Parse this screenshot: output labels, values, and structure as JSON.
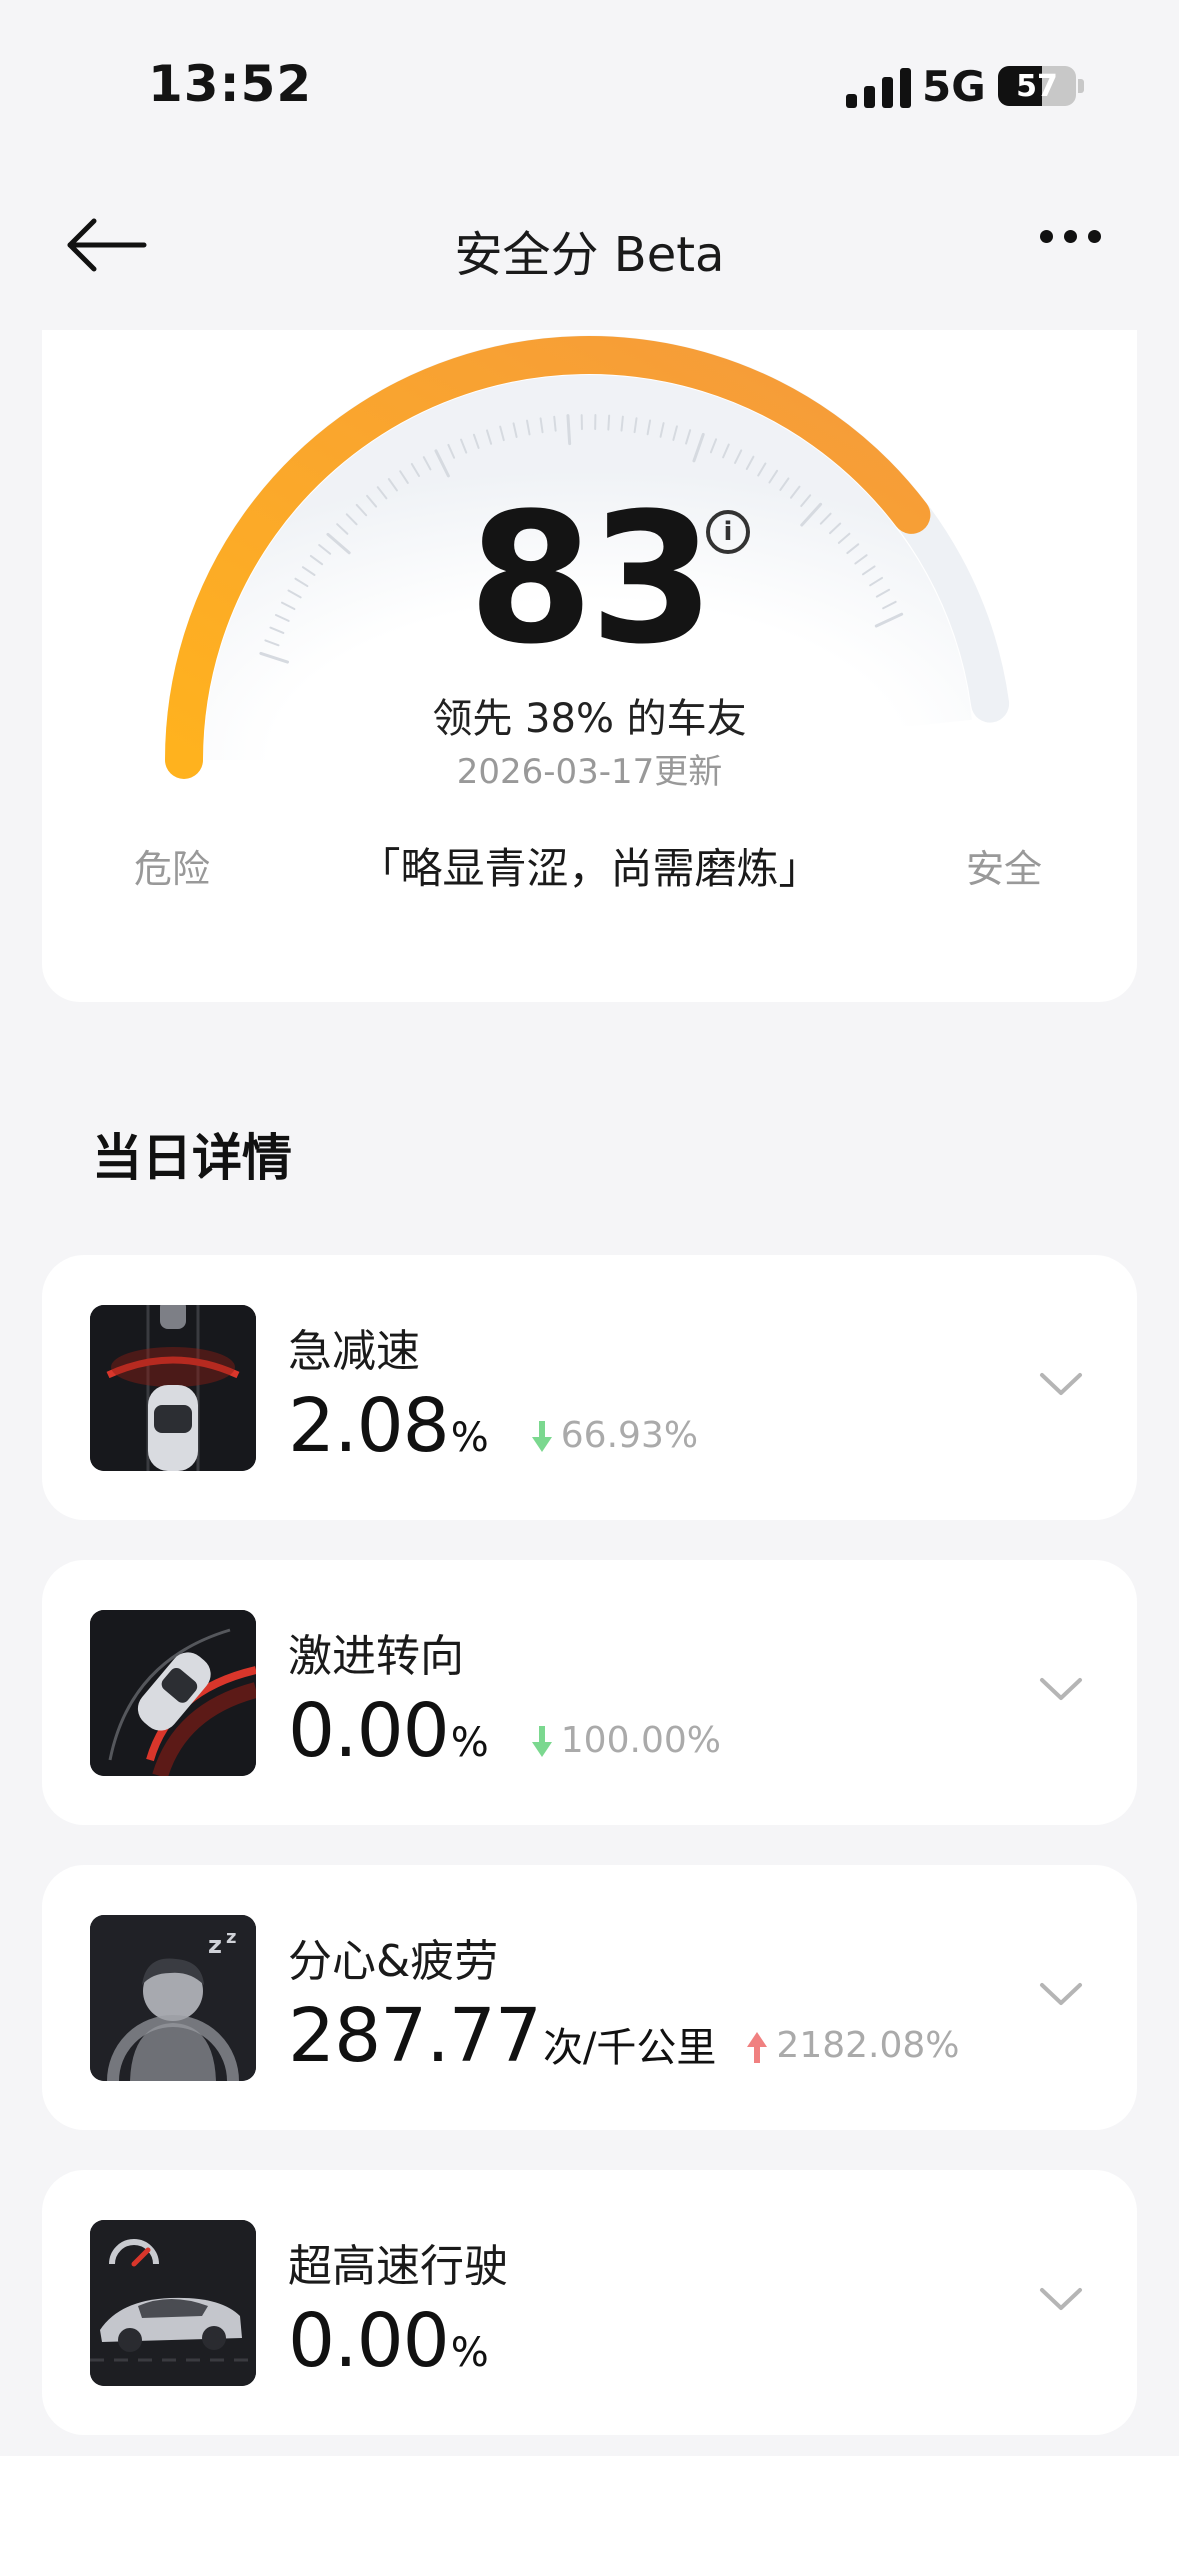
{
  "status_bar": {
    "time": "13:52",
    "network": "5G",
    "battery": "57",
    "battery_level": 0.57
  },
  "header": {
    "title": "安全分 Beta",
    "back_icon": "arrow-left-icon",
    "more_icon": "more-dots-icon"
  },
  "score_card": {
    "score": "83",
    "score_value": 83,
    "info_icon": "info-icon",
    "rank_text": "领先 38% 的车友",
    "updated_text": "2026-03-17更新",
    "left_label": "危险",
    "right_label": "安全",
    "comment": "「略显青涩，尚需磨炼」",
    "colors": {
      "arc_start": "#FFB21E",
      "arc_end": "#F59A3C",
      "track": "#EEF1F5"
    }
  },
  "section_title": "当日详情",
  "metrics": [
    {
      "name": "急减速",
      "value": "2.08",
      "unit": "%",
      "change": "66.93%",
      "direction": "down",
      "icon": "hard-braking-icon"
    },
    {
      "name": "激进转向",
      "value": "0.00",
      "unit": "%",
      "change": "100.00%",
      "direction": "down",
      "icon": "aggressive-steering-icon"
    },
    {
      "name": "分心&疲劳",
      "value": "287.77",
      "unit": "次/千公里",
      "change": "2182.08%",
      "direction": "up",
      "icon": "distraction-fatigue-icon"
    },
    {
      "name": "超高速行驶",
      "value": "0.00",
      "unit": "%",
      "change": "",
      "direction": "",
      "icon": "speeding-icon"
    }
  ],
  "colors": {
    "down": "#7BD88F",
    "up": "#F08080"
  }
}
